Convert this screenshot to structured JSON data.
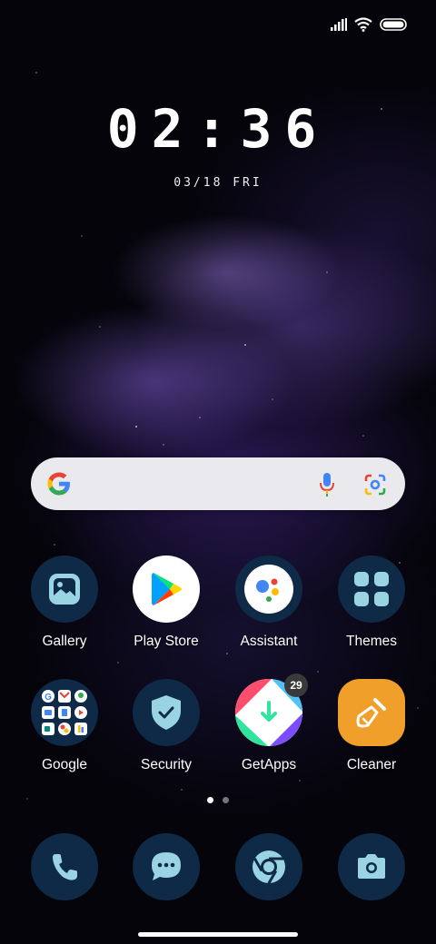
{
  "status_bar": {
    "icons": [
      "signal-icon",
      "wifi-icon",
      "battery-icon"
    ]
  },
  "clock": {
    "time": "02:36",
    "date": "03/18 FRI"
  },
  "search_bar": {
    "icons": [
      "google-logo-icon",
      "microphone-icon",
      "google-lens-icon"
    ]
  },
  "apps_row1": [
    {
      "label": "Gallery",
      "icon": "gallery-icon"
    },
    {
      "label": "Play Store",
      "icon": "play-store-icon"
    },
    {
      "label": "Assistant",
      "icon": "assistant-icon"
    },
    {
      "label": "Themes",
      "icon": "themes-icon"
    }
  ],
  "apps_row2": [
    {
      "label": "Google",
      "icon": "google-folder-icon"
    },
    {
      "label": "Security",
      "icon": "security-shield-icon"
    },
    {
      "label": "GetApps",
      "icon": "getapps-icon",
      "badge": "29"
    },
    {
      "label": "Cleaner",
      "icon": "cleaner-brush-icon"
    }
  ],
  "page_indicator": {
    "pages": 2,
    "current": 1
  },
  "dock": [
    {
      "icon": "phone-icon"
    },
    {
      "icon": "messages-icon"
    },
    {
      "icon": "chrome-icon"
    },
    {
      "icon": "camera-icon"
    }
  ],
  "colors": {
    "icon_background": "#0f2a47",
    "icon_glyph": "#9ad4e2",
    "search_bar": "#e9e9ee",
    "cleaner": "#f0a02a"
  }
}
